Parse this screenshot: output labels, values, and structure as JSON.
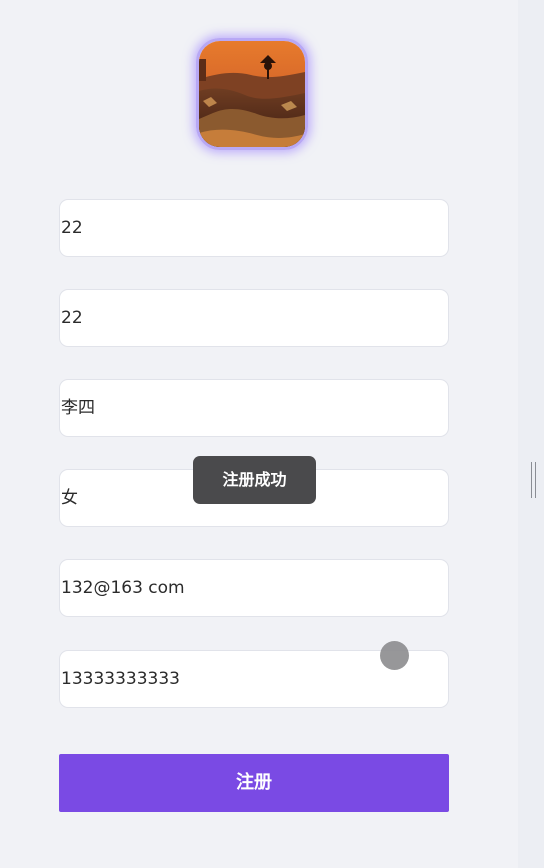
{
  "form": {
    "fields": [
      {
        "value": "22"
      },
      {
        "value": "22"
      },
      {
        "value": "李四"
      },
      {
        "value": "女"
      },
      {
        "value": "132@163 com"
      },
      {
        "value": "13333333333"
      }
    ],
    "submit_label": "注册"
  },
  "toast": {
    "message": "注册成功"
  },
  "icons": {
    "avatar": "avatar-image",
    "scroll": "scroll-handle-icon"
  },
  "colors": {
    "accent": "#7a4ae4",
    "toast_bg": "#4a4a4c",
    "avatar_glow": "#b8a8f5"
  }
}
